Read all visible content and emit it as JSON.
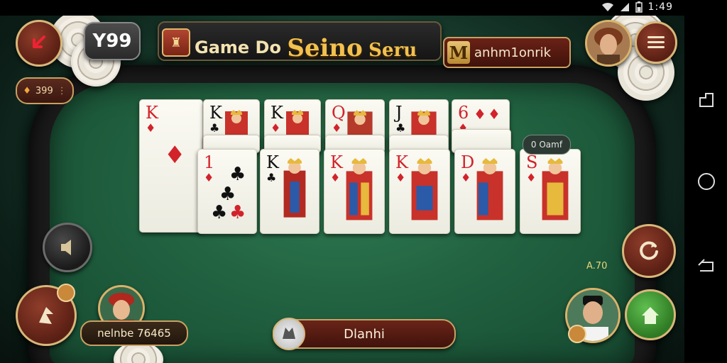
{
  "status": {
    "time": "1:49"
  },
  "header": {
    "back_icon": "back-arrow-icon",
    "badge": "Y99",
    "title_prefix": "Game Do",
    "title_gold": "Seino",
    "title_suffix": "Seru",
    "player_name_initial": "M",
    "player_name": "anhm1onrik",
    "menu_icon": "menu-icon"
  },
  "coins": {
    "amount": "399"
  },
  "table": {
    "info_label": "0 Oamf",
    "score": "A.70",
    "player_label": "nelnbe 76465",
    "chat_label": "Dlanhi",
    "colors": {
      "felt": "#1f5e3e",
      "accent": "#c9a063",
      "button": "#5a1f14"
    }
  },
  "cards": {
    "top_row": [
      {
        "rank": "K",
        "suit": "♦",
        "color": "red"
      },
      {
        "rank": "K",
        "suit": "♣",
        "color": "black"
      },
      {
        "rank": "K",
        "suit": "♦",
        "color": "black"
      },
      {
        "rank": "Q",
        "suit": "♦",
        "color": "red"
      },
      {
        "rank": "J",
        "suit": "♣",
        "color": "black"
      },
      {
        "rank": "6",
        "suit": "♦",
        "color": "red"
      }
    ],
    "bottom_row": [
      {
        "rank": "1",
        "suit": "♦",
        "color": "red"
      },
      {
        "rank": "K",
        "suit": "♣",
        "color": "black"
      },
      {
        "rank": "K",
        "suit": "♦",
        "color": "red"
      },
      {
        "rank": "K",
        "suit": "♦",
        "color": "red"
      },
      {
        "rank": "D",
        "suit": "♦",
        "color": "red"
      },
      {
        "rank": "S",
        "suit": "♦",
        "color": "red"
      }
    ]
  }
}
